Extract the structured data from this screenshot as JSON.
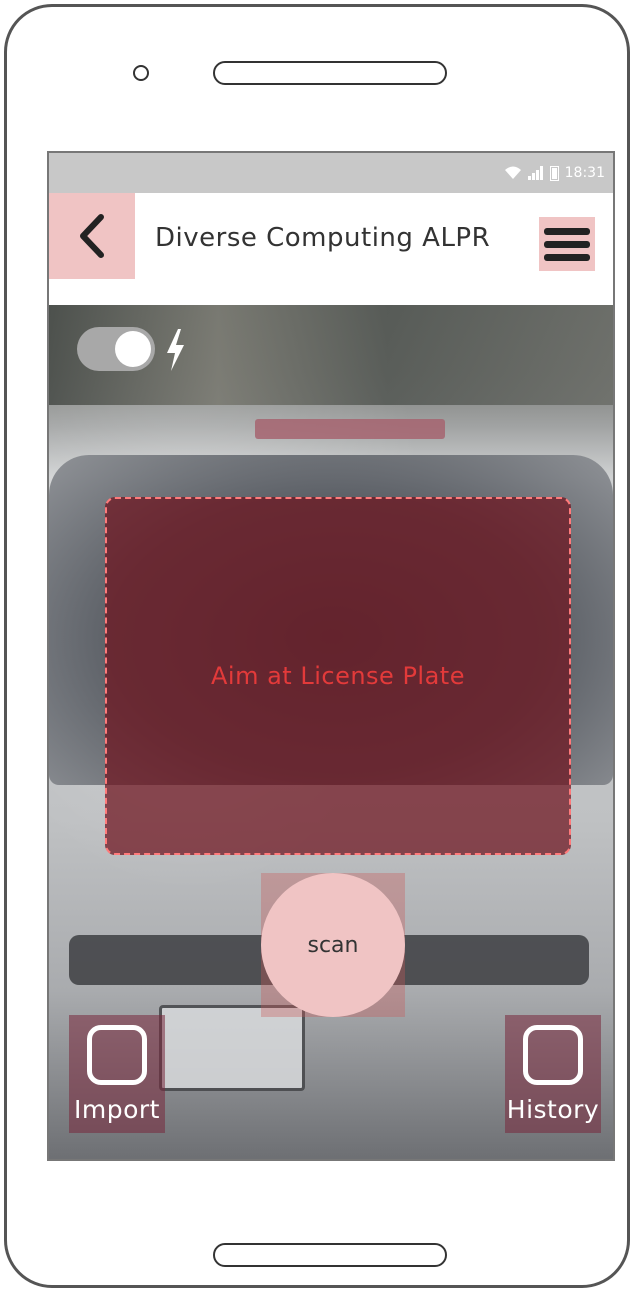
{
  "status_bar": {
    "wifi_icon": "wifi-icon",
    "signal_icon": "signal-icon",
    "battery_icon": "battery-icon",
    "time": "18:31"
  },
  "header": {
    "back_icon": "chevron-left-icon",
    "title": "Diverse Computing ALPR",
    "menu_icon": "hamburger-menu-icon"
  },
  "camera": {
    "flash_toggle_on": true,
    "flash_icon": "lightning-icon",
    "aim_text": "Aim at License Plate"
  },
  "actions": {
    "scan_label": "scan",
    "import_label": "Import",
    "history_label": "History"
  },
  "colors": {
    "button_pink": "#f0c4c4",
    "aim_overlay": "#6e141e",
    "aim_text": "#e33a3a"
  }
}
